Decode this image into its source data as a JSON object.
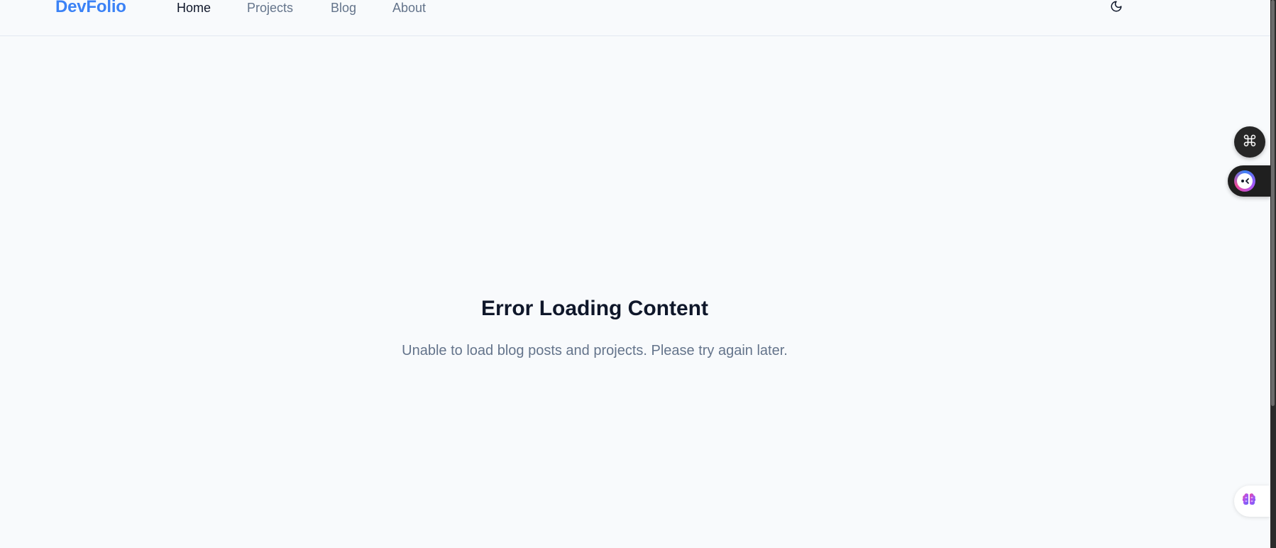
{
  "header": {
    "brand": "DevFolio",
    "nav": [
      {
        "label": "Home",
        "active": true
      },
      {
        "label": "Projects",
        "active": false
      },
      {
        "label": "Blog",
        "active": false
      },
      {
        "label": "About",
        "active": false
      }
    ],
    "theme_toggle_icon": "moon-icon"
  },
  "main": {
    "error_title": "Error Loading Content",
    "error_message": "Unable to load blog posts and projects. Please try again later."
  },
  "floating_widgets": {
    "command_icon": "command-icon",
    "assistant_icon": "assistant-face-icon",
    "brain_icon": "brain-icon"
  },
  "colors": {
    "background": "#f8fafc",
    "brand": "#3b82f6",
    "nav_text": "#64748b",
    "nav_active": "#0f172a",
    "title": "#0f172a",
    "message": "#64748b"
  }
}
